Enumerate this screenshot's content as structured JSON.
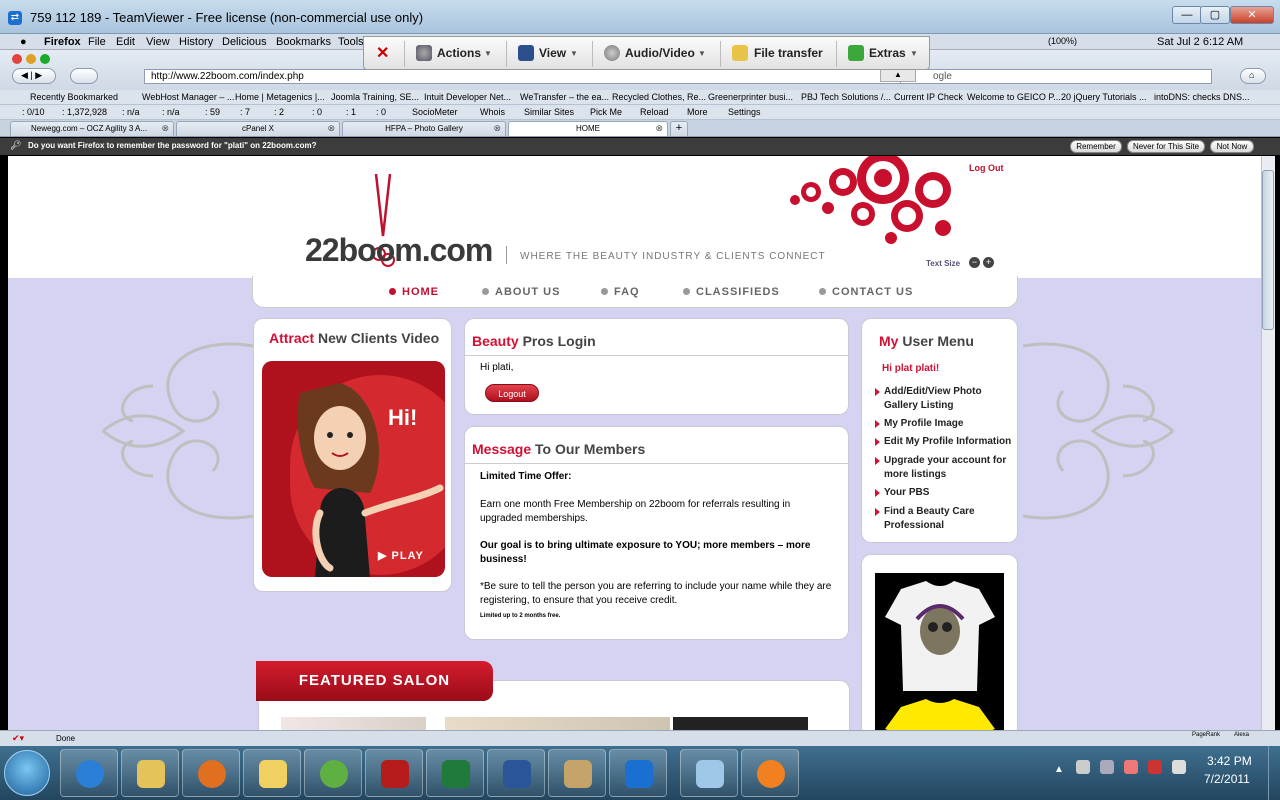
{
  "teamviewer": {
    "title": "759 112 189 - TeamViewer - Free license (non-commercial use only)",
    "toolbar": [
      "Actions",
      "View",
      "Audio/Video",
      "File transfer",
      "Extras"
    ]
  },
  "mac_menu": {
    "app": "Firefox",
    "items": [
      "File",
      "Edit",
      "View",
      "History",
      "Delicious",
      "Bookmarks",
      "Tools"
    ],
    "status": [
      "(100%)",
      "Sat Jul 2  6:12 AM"
    ]
  },
  "browser": {
    "url": "http://www.22boom.com/index.php",
    "search_text": "ogle",
    "bookmarks": [
      "Recently Bookmarked",
      "WebHost Manager – ...",
      "Home | Metagenics |...",
      "Joomla Training, SE...",
      "Intuit Developer Net...",
      "WeTransfer – the ea...",
      "Recycled Clothes, Re...",
      "Greenerprinter busi...",
      "PBJ Tech Solutions /...",
      "Current IP Check",
      "Welcome to GEICO P...",
      "20 jQuery Tutorials ...",
      "intoDNS: checks DNS..."
    ],
    "addons": [
      ": 0/10",
      ": 1,372,928",
      ": n/a",
      ": n/a",
      ": 59",
      ": 7",
      ": 2",
      ": 0",
      ": 1",
      ": 0",
      "SocioMeter",
      "Whois",
      "Similar Sites",
      "Pick Me",
      "Reload",
      "More",
      "Settings"
    ],
    "tabs": [
      "Newegg.com – OCZ Agility 3 A...",
      "cPanel X",
      "HFPA – Photo Gallery",
      "HOME"
    ],
    "password_prompt": "Do you want Firefox to remember the password for \"plati\" on 22boom.com?",
    "password_buttons": [
      "Remember",
      "Never for This Site",
      "Not Now"
    ],
    "status": "Done",
    "status_right": [
      "PageRank",
      "Alexa"
    ]
  },
  "site": {
    "logo_prefix": "22boo",
    "logo_suffix": "m.com",
    "tagline": "WHERE THE BEAUTY INDUSTRY & CLIENTS CONNECT",
    "logout_link": "Log Out",
    "text_size": "Text Size",
    "nav": [
      "HOME",
      "ABOUT US",
      "FAQ",
      "CLASSIFIEDS",
      "CONTACT US"
    ],
    "video_panel": {
      "title_accent": "Attract",
      "title_rest": " New Clients Video",
      "greeting": "Hi!",
      "play": "PLAY"
    },
    "login_panel": {
      "title_accent": "Beauty",
      "title_rest": " Pros Login",
      "greeting": "Hi plati,",
      "button": "Logout"
    },
    "message_panel": {
      "title_accent": "Message",
      "title_rest": " To Our Members",
      "offer_title": "Limited Time Offer:",
      "p1": "Earn one month Free Membership on 22boom for referrals resulting in upgraded memberships.",
      "p2": "Our goal is to bring ultimate exposure to YOU; more members – more business!",
      "p3": "*Be sure to tell the person you are referring to include your name while they are registering, to ensure that you receive credit.",
      "fine": "Limited up to 2 months free."
    },
    "user_menu": {
      "title_accent": "My",
      "title_rest": " User Menu",
      "greeting": "Hi plat plati!",
      "items": [
        "Add/Edit/View Photo Gallery Listing",
        "My Profile Image",
        "Edit My Profile Information",
        "Upgrade your account for more listings",
        "Your PBS",
        "Find a Beauty Care Professional"
      ]
    },
    "featured": "FEATURED SALON"
  },
  "taskbar": {
    "time": "3:42 PM",
    "date": "7/2/2011"
  }
}
